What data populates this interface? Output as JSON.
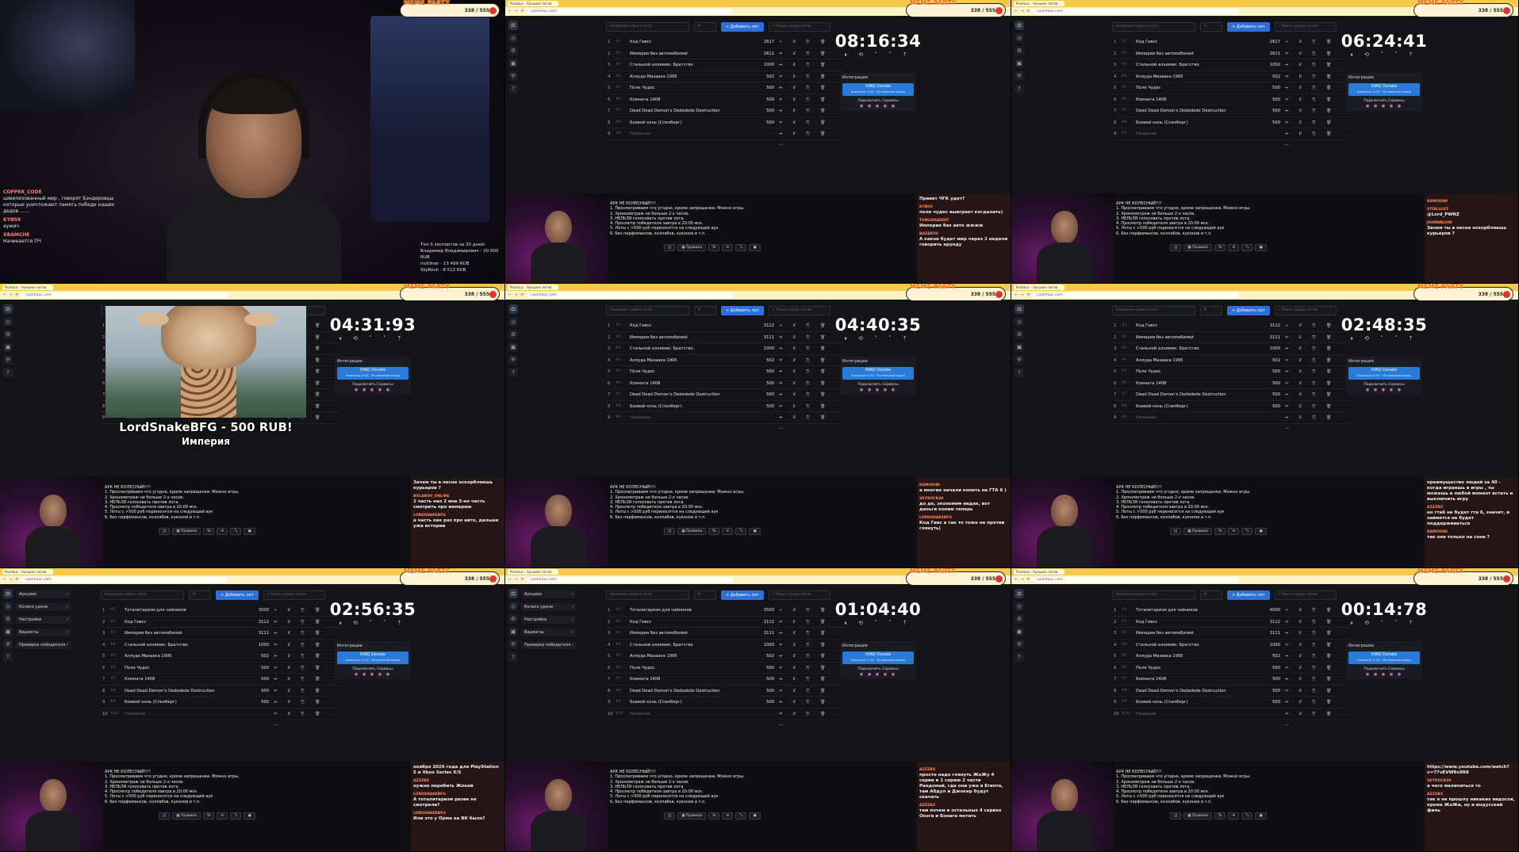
{
  "banner": {
    "logo": "MEME PARTY",
    "count": "338 / 555"
  },
  "browser": {
    "tab_title": "Pointauc - Аукцион лотов",
    "url": "r.pointauc.com"
  },
  "toolbar": {
    "lot_placeholder": "Название нового лота",
    "amount_placeholder": "₽",
    "add_button": "+ Добавить лот",
    "search_placeholder": "Поиск среди лотов"
  },
  "menu": [
    "Аукцион",
    "Колесо удачи",
    "Настройки",
    "Виджеты",
    "Проверка победителя"
  ],
  "integrations": {
    "title": "Интеграции",
    "donate_label": "IHAQ Donate",
    "donate_sub": "Комиссия: 0.5% · Мгновенный вывод",
    "connect_label": "Подключить Сервисы"
  },
  "placeholder_row": "Название",
  "rules": {
    "title": "АУК НЕ КОЛЕСНЫЙ!!!!",
    "items": [
      "1. Просматриваем что угодно, кроме запрещенки. Можно игры.",
      "2. Хронометраж не больше 2-х часов.",
      "3. НЕЛЬЗЯ голосовать против лота.",
      "4. Просмотр победителя завтра в 20:00 мск.",
      "5. Лоты с >500 руб переносятся на следующий аук",
      "6. Без перфомансов, коллабов, куконов и т.п."
    ]
  },
  "buttons_bar": [
    "◫",
    "▦ Правила",
    "%",
    "✛",
    "⤡",
    "▣"
  ],
  "panels": [
    {
      "type": "cam",
      "cam_chat": [
        {
          "user": "COPPER_CODE",
          "msg": "цивилизованный мир , говорят Бэндеровцы которые уничтожают память победе наших дедов ......"
        },
        {
          "user": "KYB0X",
          "msg": "аужич"
        },
        {
          "user": "XBAMCHE",
          "msg": "Начинается ПЧ"
        }
      ],
      "top5": [
        "Топ-3 экспертов за 30 дней:",
        "Владимир Владимирович - 20 000 RUB",
        "inckliner - 13 499 RUB",
        "SkyRock - 8 512 RUB"
      ]
    },
    {
      "type": "auction",
      "timer": "08:16:34",
      "menu": false,
      "lots": [
        {
          "t": "Код Гивсс",
          "a": "2617"
        },
        {
          "t": "Империя без автомобилей",
          "a": "2611"
        },
        {
          "t": "Стальной алхимик: Братство",
          "a": "1000"
        },
        {
          "t": "Аллуда Мазаака 1995",
          "a": "502"
        },
        {
          "t": "Поле Чудес",
          "a": "500"
        },
        {
          "t": "Комната 1408",
          "a": "500"
        },
        {
          "t": "Dead Dead Demon's Dededede Destruction",
          "a": "500"
        },
        {
          "t": "Боевой конь (Спилберг)",
          "a": "500"
        }
      ],
      "chat": [
        {
          "u": "",
          "m": "Привет ЧГК удет?"
        },
        {
          "u": "KYB0X",
          "m": "поле чудес выиграет когдалить)"
        },
        {
          "u": "TENGAMADDIT",
          "m": "Империя без авто жжжж"
        },
        {
          "u": "BAZARTH",
          "m": "А какое будет мир через 2 недели говорить ерунду"
        }
      ]
    },
    {
      "type": "auction",
      "timer": "06:24:41",
      "menu": false,
      "lots": [
        {
          "t": "Код Гивсс",
          "a": "2617"
        },
        {
          "t": "Империя без автомобилей",
          "a": "2611"
        },
        {
          "t": "Стальной алхимик: Братство",
          "a": "1000"
        },
        {
          "t": "Аллуда Мазаака 1995",
          "a": "502"
        },
        {
          "t": "Поле Чудес",
          "a": "500"
        },
        {
          "t": "Комната 1408",
          "a": "500"
        },
        {
          "t": "Dead Dead Demon's Dededede Destruction",
          "a": "500"
        },
        {
          "t": "Боевой конь (Спилберг)",
          "a": "500"
        }
      ],
      "chat": [
        {
          "u": "RAMODINI",
          "m": ""
        },
        {
          "u": "STOILILIST",
          "m": "@Lord_PWNZ"
        },
        {
          "u": "JOHNNBLOW",
          "m": "Зачем ты в песне оскорбляешь курьеров ?"
        }
      ]
    },
    {
      "type": "giraffe",
      "timer": "04:31:93",
      "gtitle": "LordSnakeBFG - 500 RUB!",
      "gsub": "Империя",
      "lots": [
        {
          "t": "",
          "a": ""
        },
        {
          "t": "",
          "a": ""
        },
        {
          "t": "",
          "a": ""
        },
        {
          "t": "",
          "a": ""
        },
        {
          "t": "",
          "a": ""
        },
        {
          "t": "",
          "a": ""
        },
        {
          "t": "",
          "a": ""
        },
        {
          "t": "",
          "a": ""
        }
      ],
      "chat": [
        {
          "u": "",
          "m": "Зачем ты в песне оскорбляешь курьеров ?"
        },
        {
          "u": "BULANOV_ONLINE",
          "m": "1 часть нао 2 ина 3-но часть смотреть про империю"
        },
        {
          "u": "LORDSNAKEBFG",
          "m": "а часть как раз про авто, дальше ужа истории"
        }
      ]
    },
    {
      "type": "auction",
      "timer": "04:40:35",
      "menu": false,
      "lots": [
        {
          "t": "Код Гивсс",
          "a": "3112"
        },
        {
          "t": "Империя без автомобилей",
          "a": "3111"
        },
        {
          "t": "Стальной алхимик: Братство",
          "a": "1000"
        },
        {
          "t": "Аллуда Мазаака 1995",
          "a": "502"
        },
        {
          "t": "Поле Чудес",
          "a": "500"
        },
        {
          "t": "Комната 1408",
          "a": "500"
        },
        {
          "t": "Dead Dead Demon's Dededede Destruction",
          "a": "500"
        },
        {
          "t": "Боевой конь (Спилберг)",
          "a": "500"
        }
      ],
      "chat": [
        {
          "u": "RAMODINI",
          "m": "а многие начали копить на ГТА 6 )"
        },
        {
          "u": "SKYROCK49",
          "m": "до де, экономим видак, вот деньги копим теперь"
        },
        {
          "u": "LORDSNAKEBFG",
          "m": "Код Гивс а так то тоже не против глянуть)"
        }
      ]
    },
    {
      "type": "auction",
      "timer": "02:48:35",
      "menu": false,
      "lots": [
        {
          "t": "Код Гивсс",
          "a": "3112"
        },
        {
          "t": "Империя без автомобилей",
          "a": "3111"
        },
        {
          "t": "Стальной алхимик: Братство",
          "a": "1000"
        },
        {
          "t": "Аллуда Мазаака 1995",
          "a": "502"
        },
        {
          "t": "Поле Чудес",
          "a": "500"
        },
        {
          "t": "Комната 1408",
          "a": "500"
        },
        {
          "t": "Dead Dead Demon's Dededede Destruction",
          "a": "500"
        },
        {
          "t": "Боевой конь (Спилберг)",
          "a": "500"
        }
      ],
      "chat": [
        {
          "u": "",
          "m": "преимущество людей за 40 - когда играешь в игры , ты можешь в любой момент встать и выключить игру"
        },
        {
          "u": "AZZZBX",
          "m": "но гта6 не будет гта 6, значит, и займется не будет поддерживаться"
        },
        {
          "u": "RAMODINI",
          "m": "так она только на сони ?"
        }
      ]
    },
    {
      "type": "auction",
      "timer": "02:56:35",
      "menu": true,
      "lots": [
        {
          "t": "Тоталитаризм для чайников",
          "a": "3500"
        },
        {
          "t": "Код Гивсс",
          "a": "3112"
        },
        {
          "t": "Империя без автомобилей",
          "a": "3111"
        },
        {
          "t": "Стальной алхимик: Братство",
          "a": "1000"
        },
        {
          "t": "Аллуда Мазаака 1995",
          "a": "502"
        },
        {
          "t": "Поле Чудес",
          "a": "500"
        },
        {
          "t": "Комната 1408",
          "a": "500"
        },
        {
          "t": "Dead Dead Demon's Dededede Destruction",
          "a": "500"
        },
        {
          "t": "Боевой конь (Спилберг)",
          "a": "500"
        }
      ],
      "chat": [
        {
          "u": "",
          "m": "ноября 2026 года для PlayStation 5 и Xbox Series X/S"
        },
        {
          "u": "AZZZBX",
          "m": "нужно перебить Жокей"
        },
        {
          "u": "LORDSNAKEBFG",
          "m": "А тоталитаризм разве не смотрели?"
        },
        {
          "u": "LORDSNAKEBFG",
          "m": "Или это у Орма на ВК было?"
        }
      ]
    },
    {
      "type": "auction",
      "timer": "01:04:40",
      "menu": true,
      "lots": [
        {
          "t": "Тоталитаризм для чайников",
          "a": "3500"
        },
        {
          "t": "Код Гивсс",
          "a": "3112"
        },
        {
          "t": "Империя без автомобилей",
          "a": "3111"
        },
        {
          "t": "Стальной алхимик: Братство",
          "a": "1000"
        },
        {
          "t": "Аллуда Мазаака 1995",
          "a": "502"
        },
        {
          "t": "Поле Чудес",
          "a": "500"
        },
        {
          "t": "Комната 1408",
          "a": "500"
        },
        {
          "t": "Dead Dead Demon's Dededede Destruction",
          "a": "500"
        },
        {
          "t": "Боевой конь (Спилберг)",
          "a": "500"
        }
      ],
      "chat": [
        {
          "u": "AZZZBX",
          "m": "просто надо глянуть ЖоЖу 4 серии и 1 серию 2 части Рандомай, где они уже в Египте, там Абдул и Джокер будут скачать"
        },
        {
          "u": "AZZZBX",
          "m": "там почем в остальных 4 сериях Онэга и Бонага мотать"
        }
      ]
    },
    {
      "type": "auction",
      "timer": "00:14:78",
      "menu": false,
      "lots": [
        {
          "t": "Тоталитаризм для чайников",
          "a": "4000"
        },
        {
          "t": "Код Гивсс",
          "a": "3112"
        },
        {
          "t": "Империя без автомобилей",
          "a": "3111"
        },
        {
          "t": "Стальной алхимик: Братство",
          "a": "1000"
        },
        {
          "t": "Аллуда Мазаака 1995",
          "a": "502"
        },
        {
          "t": "Поле Чудес",
          "a": "500"
        },
        {
          "t": "Комната 1408",
          "a": "500"
        },
        {
          "t": "Dead Dead Demon's Dededede Destruction",
          "a": "500"
        },
        {
          "t": "Боевой конь (Спилберг)",
          "a": "500"
        }
      ],
      "chat": [
        {
          "u": "",
          "m": "https://www.youtube.com/watch?v=77vEVW9x9R8"
        },
        {
          "u": "SKYROCK49",
          "m": "а чего меличиться то"
        },
        {
          "u": "AZZZBX",
          "m": "так я не прошлу никаких видосов, кроме ЖоЖи, ну и индусский филь"
        }
      ]
    }
  ]
}
